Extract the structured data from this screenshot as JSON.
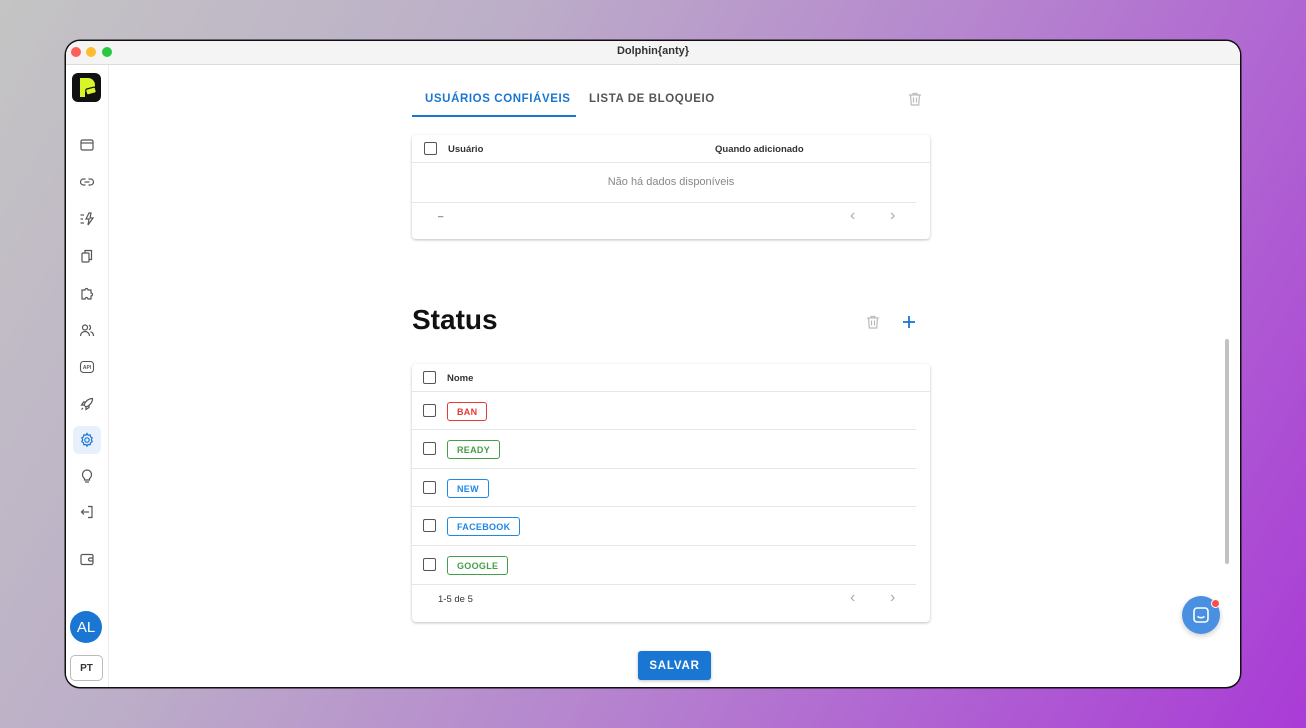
{
  "window": {
    "title": "Dolphin{anty}"
  },
  "sidebar": {
    "nav_icons": [
      "browser-icon",
      "link-icon",
      "automation-icon",
      "copy-icon",
      "extensions-icon",
      "users-icon",
      "api-icon",
      "rocket-icon",
      "settings-icon",
      "lightbulb-icon",
      "logout-icon",
      "wallet-icon"
    ],
    "active": "settings-icon",
    "avatar_initials": "AL",
    "language": "PT"
  },
  "tabs": [
    {
      "label": "USUÁRIOS CONFIÁVEIS",
      "active": true
    },
    {
      "label": "LISTA DE BLOQUEIO",
      "active": false
    }
  ],
  "trusted_table": {
    "columns": [
      "Usuário",
      "Quando adicionado"
    ],
    "empty_text": "Não há dados disponíveis",
    "pagination": "–"
  },
  "status": {
    "title": "Status",
    "column": "Nome",
    "rows": [
      {
        "label": "BAN",
        "color": "#e53935"
      },
      {
        "label": "READY",
        "color": "#43a047"
      },
      {
        "label": "NEW",
        "color": "#1e88e5"
      },
      {
        "label": "FACEBOOK",
        "color": "#1e88e5"
      },
      {
        "label": "GOOGLE",
        "color": "#43a047"
      }
    ],
    "pagination": "1-5 de 5"
  },
  "save_label": "SALVAR",
  "colors": {
    "accent": "#1976d2"
  }
}
